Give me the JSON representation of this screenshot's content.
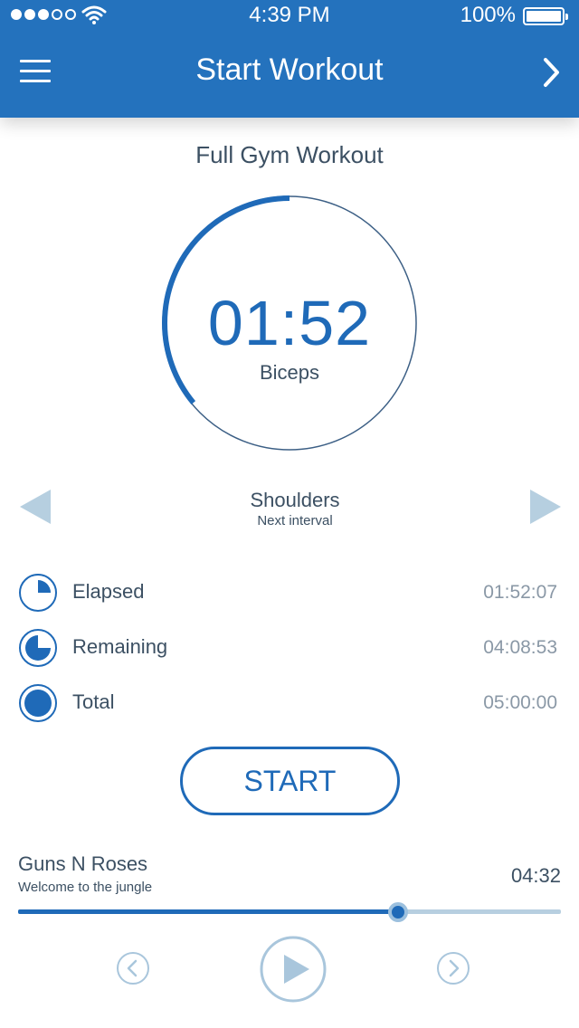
{
  "status_bar": {
    "time": "4:39 PM",
    "battery": "100%",
    "signal_bars": 3,
    "signal_total": 5
  },
  "header": {
    "title": "Start Workout",
    "menu_icon": "hamburger-icon",
    "next_icon": "chevron-right-icon"
  },
  "workout": {
    "name": "Full Gym Workout",
    "timer": "01:52",
    "current_exercise": "Biceps",
    "interval_progress": 0.36
  },
  "next_interval": {
    "name": "Shoulders",
    "label": "Next interval"
  },
  "stats": [
    {
      "label": "Elapsed",
      "value": "01:52:07",
      "icon": "pie-quarter-icon"
    },
    {
      "label": "Remaining",
      "value": "04:08:53",
      "icon": "pie-three-quarter-icon"
    },
    {
      "label": "Total",
      "value": "05:00:00",
      "icon": "pie-full-icon"
    }
  ],
  "start_label": "START",
  "music": {
    "artist": "Guns N Roses",
    "song": "Welcome to the jungle",
    "time": "04:32",
    "progress": 0.7
  },
  "colors": {
    "primary": "#2472bd",
    "accent": "#1f6ab8",
    "muted": "#b7cfe0",
    "text": "#3c5063"
  }
}
